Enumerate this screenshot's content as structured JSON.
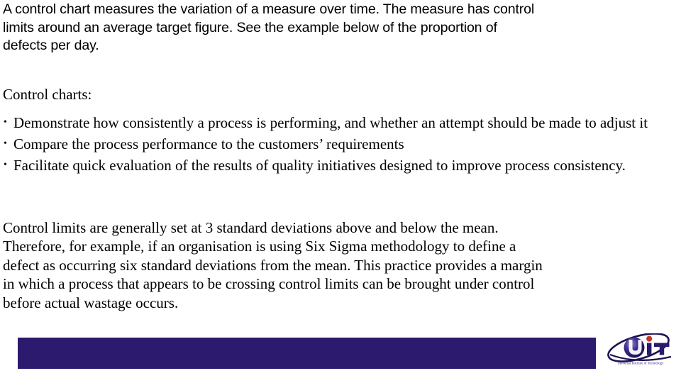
{
  "slide": {
    "intro": {
      "lines": [
        "A control chart measures the variation of a measure over time. The measure has control",
        "limits around an average target figure. See the example below of the proportion of",
        "defects per day."
      ]
    },
    "lead_in": "Control charts:",
    "bullets": [
      {
        "marker": "•",
        "text": "Demonstrate how consistently a process is performing, and whether an attempt should be made to adjust it"
      },
      {
        "marker": "•",
        "text": "Compare the process performance to the customers’ requirements"
      },
      {
        "marker": "•",
        "text": "Facilitate quick evaluation of the results of quality initiatives designed to improve process consistency."
      }
    ],
    "closing": {
      "lines": [
        "Control limits are generally set at 3 standard deviations above and below the mean.",
        "Therefore, for example,  if an organisation is using Six Sigma methodology to define a",
        "defect as occurring six standard deviations from the mean. This practice provides a margin",
        "in which a process that appears to be crossing control limits can be brought under control",
        "before actual wastage occurs."
      ]
    },
    "footer": {
      "bar_color": "#2b1a6d"
    },
    "logo": {
      "letters": "UiT",
      "tagline": "Universal Institute of Technology",
      "dot_color": "#c0392b",
      "ink_color": "#2b1a6d",
      "sphere_color": "#3a2a8a"
    }
  }
}
